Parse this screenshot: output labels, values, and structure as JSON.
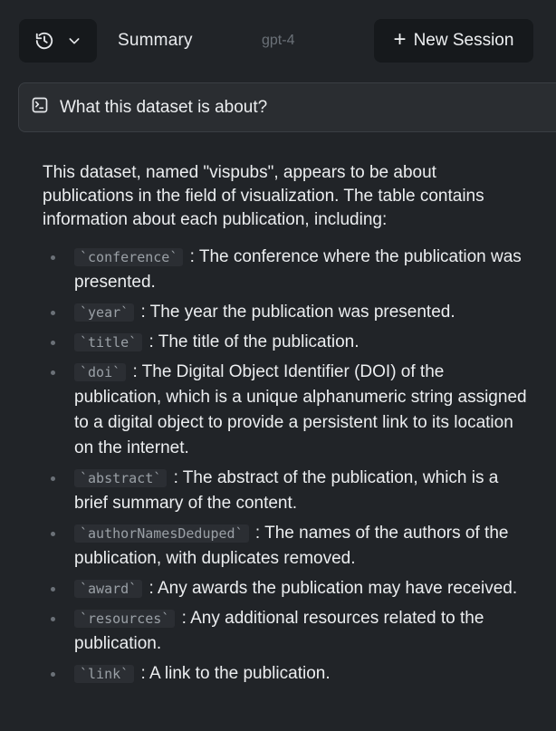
{
  "header": {
    "history_icon": "history-clock-icon",
    "dropdown_icon": "chevron-down-icon",
    "title": "Summary",
    "model": "gpt-4",
    "new_session_label": "New Session",
    "new_session_icon": "plus-icon"
  },
  "question": {
    "icon": "prompt-icon",
    "text": "What this dataset is about?"
  },
  "answer": {
    "intro": "This dataset, named \"vispubs\", appears to be about publications in the field of visualization. The table contains information about each publication, including:",
    "items": [
      {
        "code": "`conference`",
        "text": ": The conference where the publication was presented."
      },
      {
        "code": "`year`",
        "text": ": The year the publication was presented."
      },
      {
        "code": "`title`",
        "text": ": The title of the publication."
      },
      {
        "code": "`doi`",
        "text": ": The Digital Object Identifier (DOI) of the publication, which is a unique alphanumeric string assigned to a digital object to provide a persistent link to its location on the internet."
      },
      {
        "code": "`abstract`",
        "text": ": The abstract of the publication, which is a brief summary of the content."
      },
      {
        "code": "`authorNamesDeduped`",
        "text": ": The names of the authors of the publication, with duplicates removed."
      },
      {
        "code": "`award`",
        "text": ": Any awards the publication may have received."
      },
      {
        "code": "`resources`",
        "text": ": Any additional resources related to the publication."
      },
      {
        "code": "`link`",
        "text": ": A link to the publication."
      }
    ]
  }
}
